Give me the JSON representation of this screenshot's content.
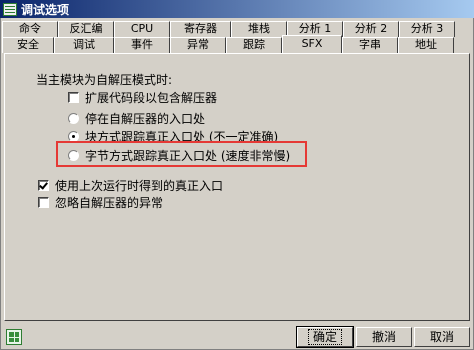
{
  "window": {
    "title": "调试选项"
  },
  "tabs": {
    "row1": [
      "命令",
      "反汇编",
      "CPU",
      "寄存器",
      "堆栈",
      "分析 1",
      "分析 2",
      "分析 3"
    ],
    "row2": [
      "安全",
      "调试",
      "事件",
      "异常",
      "跟踪",
      "SFX",
      "字串",
      "地址"
    ],
    "active": "SFX"
  },
  "sfx": {
    "group_label": "当主模块为自解压模式时:",
    "extend_code": {
      "label": "扩展代码段以包含解压器",
      "checked": false
    },
    "radios": [
      {
        "label": "停在自解压器的入口处",
        "checked": false
      },
      {
        "label": "块方式跟踪真正入口处 (不一定准确)",
        "checked": true
      },
      {
        "label": "字节方式跟踪真正入口处 (速度非常慢)",
        "checked": false
      }
    ],
    "use_last_entry": {
      "label": "使用上次运行时得到的真正入口",
      "checked": true
    },
    "ignore_exceptions": {
      "label": "忽略自解压器的异常",
      "checked": false
    },
    "highlight_color": "#e53935"
  },
  "buttons": {
    "ok": "确定",
    "cancel": "撤消",
    "close": "取消"
  },
  "icons": {
    "title": "window-app-icon",
    "corner": "corner-app-icon"
  }
}
